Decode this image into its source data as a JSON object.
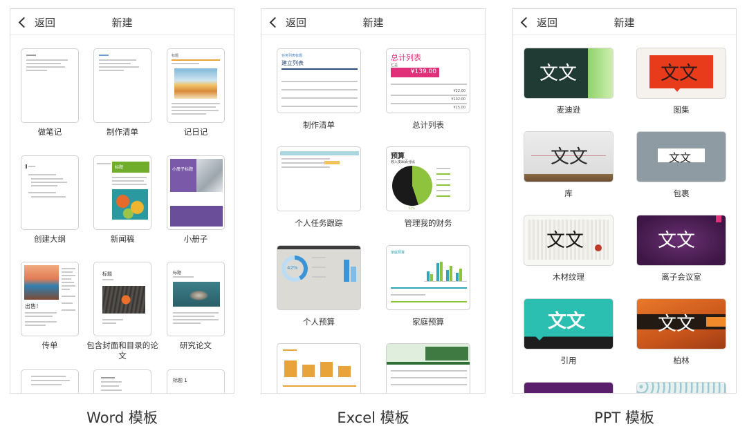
{
  "nav": {
    "back_label": "返回",
    "title": "新建"
  },
  "captions": {
    "word": "Word 模板",
    "excel": "Excel 模板",
    "ppt": "PPT 模板"
  },
  "word": {
    "items": [
      {
        "label": "做笔记"
      },
      {
        "label": "制作清单"
      },
      {
        "label": "记日记"
      },
      {
        "label": "创建大纲"
      },
      {
        "label": "新闻稿"
      },
      {
        "label": "小册子"
      },
      {
        "label": "传单"
      },
      {
        "label": "包含封面和目录的论文"
      },
      {
        "label": "研究论文"
      }
    ],
    "thumb_text": {
      "diary_title": "标题",
      "press_title": "标题",
      "booklet_title": "小册子标题",
      "flyer_title": "出售！",
      "paper_title": "标题",
      "research_title": "标题",
      "partial_title": "标题 1"
    }
  },
  "excel": {
    "items": [
      {
        "label": "制作清单"
      },
      {
        "label": "总计列表"
      },
      {
        "label": "个人任务跟踪"
      },
      {
        "label": "管理我的财务"
      },
      {
        "label": "个人预算"
      },
      {
        "label": "家庭预算"
      }
    ],
    "thumb_text": {
      "list_small": "任务列表标题",
      "list_title": "建立列表",
      "total_title": "总计列表",
      "total_sub": "汇总",
      "total_amount": "¥139.00",
      "total_rows": [
        "¥22.00",
        "¥102.00",
        "¥15.00"
      ],
      "finance_title": "预算",
      "finance_sub": "收入支出百分比",
      "finance_pct": "55%",
      "budget_pct": "42%",
      "family_title": "家庭预算"
    }
  },
  "ppt": {
    "items": [
      {
        "label": "麦迪逊",
        "text": "文文"
      },
      {
        "label": "图集",
        "text": "文文"
      },
      {
        "label": "库",
        "text": "文文"
      },
      {
        "label": "包裹",
        "text": "文文"
      },
      {
        "label": "木材纹理",
        "text": "文文"
      },
      {
        "label": "离子会议室",
        "text": "文文"
      },
      {
        "label": "引用",
        "text": "文文"
      },
      {
        "label": "柏林",
        "text": "文文"
      }
    ]
  }
}
